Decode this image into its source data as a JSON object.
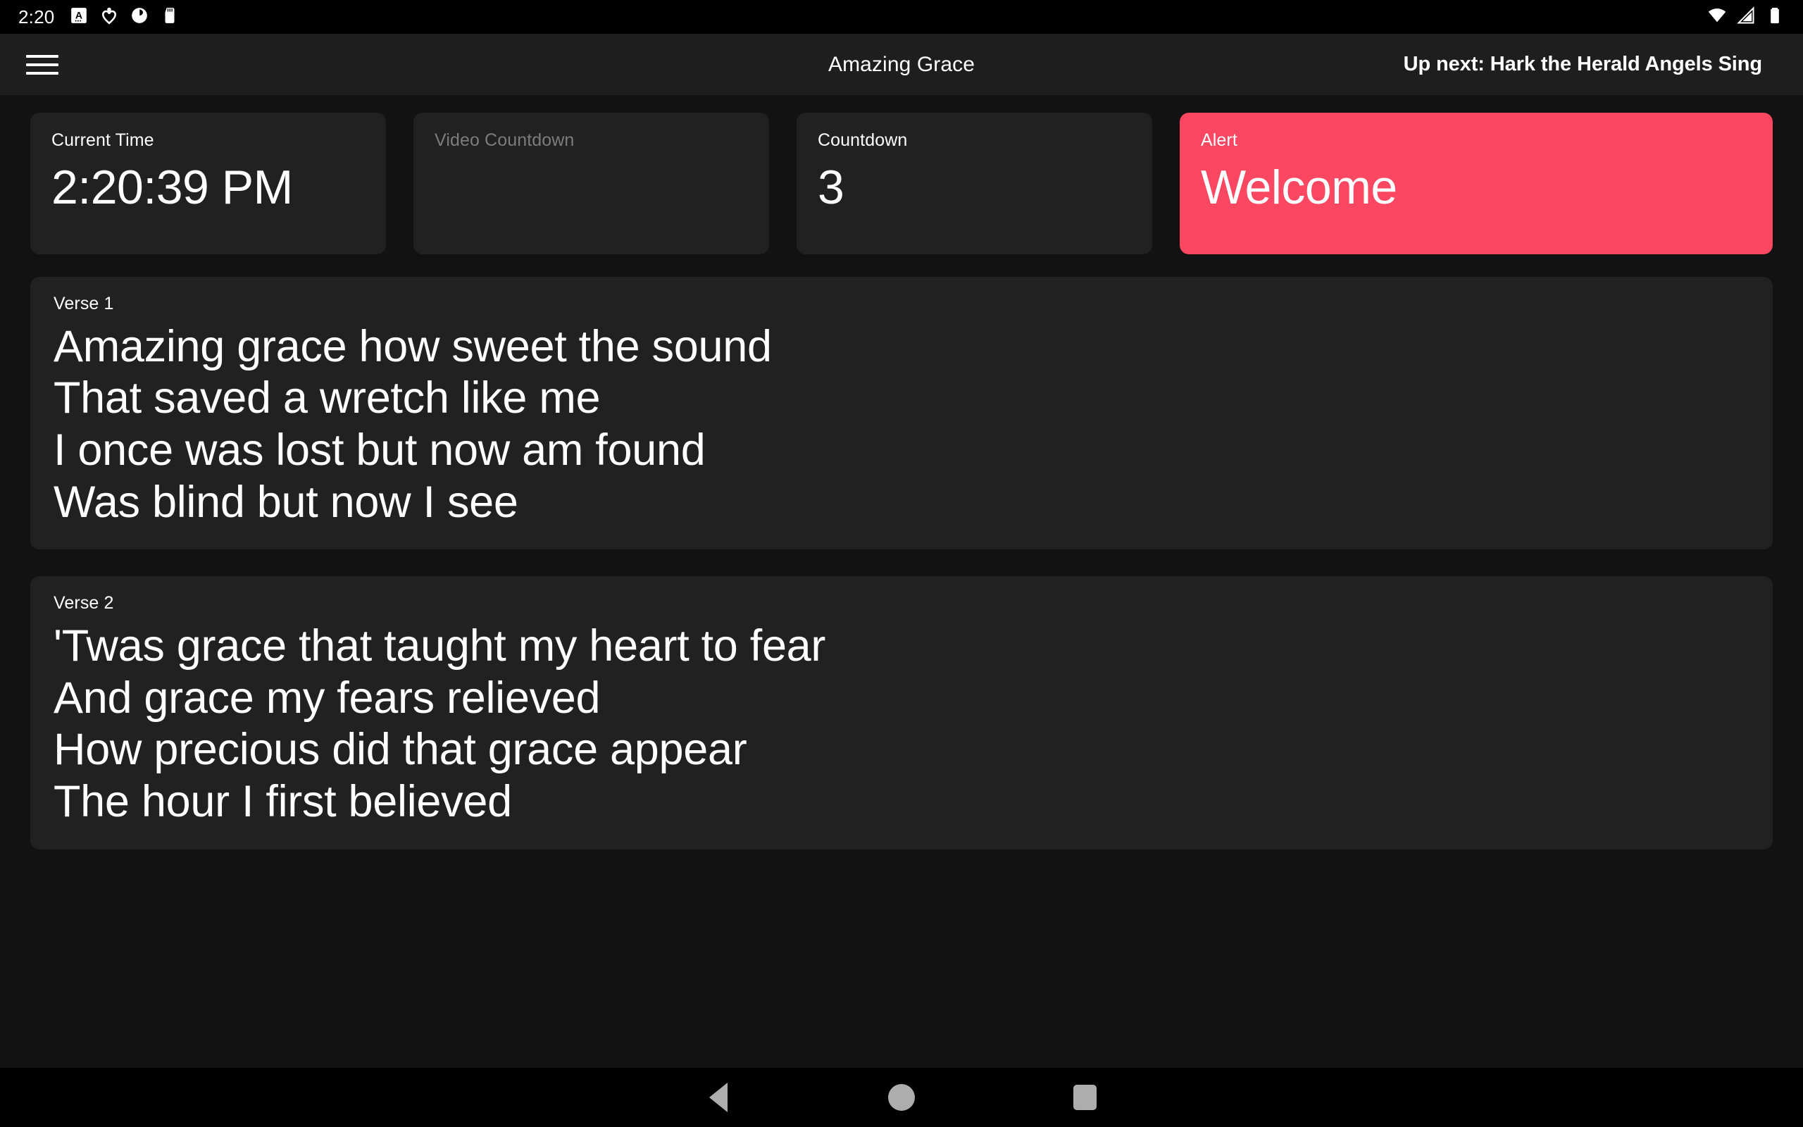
{
  "status_bar": {
    "clock": "2:20",
    "left_icons": [
      "font-size-icon",
      "heart-outline-icon",
      "moon-circle-icon",
      "sd-card-icon"
    ],
    "right_icons": [
      "wifi-icon",
      "cellular-signal-icon",
      "battery-icon"
    ]
  },
  "app_bar": {
    "menu_icon": "hamburger-menu-icon",
    "title": "Amazing Grace",
    "up_next": "Up next: Hark the Herald Angels Sing"
  },
  "cards": [
    {
      "label": "Current Time",
      "value": "2:20:39 PM",
      "dim": false
    },
    {
      "label": "Video Countdown",
      "value": "",
      "dim": true
    },
    {
      "label": "Countdown",
      "value": "3",
      "dim": false
    },
    {
      "label": "Alert",
      "value": "Welcome",
      "dim": false,
      "accent": "#fb4761"
    }
  ],
  "verses": [
    {
      "label": "Verse 1",
      "lines": [
        "Amazing grace how sweet the sound",
        "That saved a wretch like me",
        "I once was lost but now am found",
        "Was blind but now I see"
      ]
    },
    {
      "label": "Verse 2",
      "lines": [
        "'Twas grace that taught my heart to fear",
        "And grace my fears relieved",
        "How precious did that grace appear",
        "The hour I first believed"
      ]
    }
  ],
  "nav_bar": {
    "back": "back-triangle-icon",
    "home": "home-circle-icon",
    "recents": "recents-square-icon"
  },
  "colors": {
    "page_background": "#121212",
    "card_background": "#212121",
    "app_bar_background": "#1e1e1e",
    "alert_accent": "#fb4761",
    "text_primary": "#ffffff",
    "text_dim": "#7c7c7c"
  }
}
